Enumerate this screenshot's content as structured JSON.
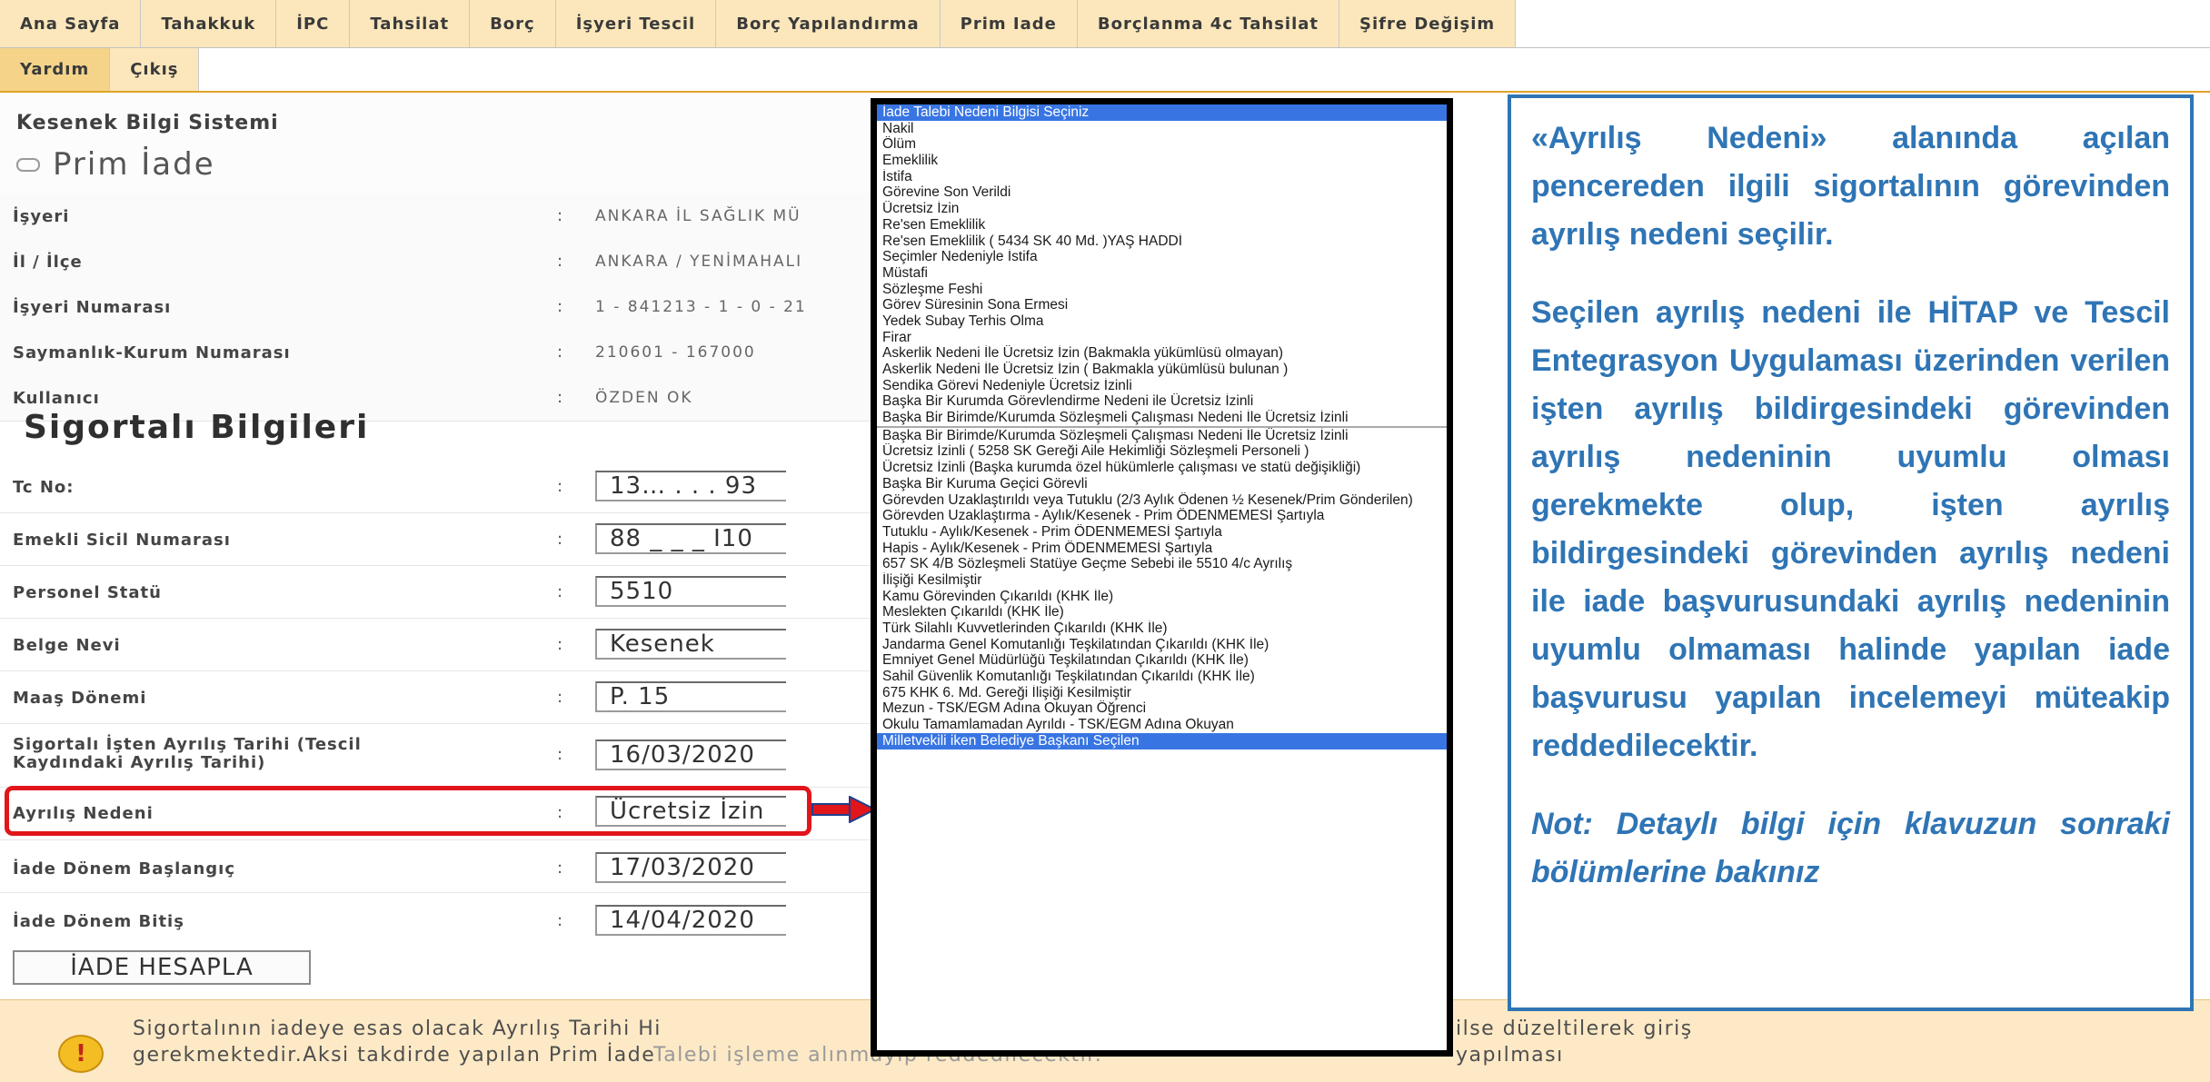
{
  "nav": {
    "row1": [
      "Ana Sayfa",
      "Tahakkuk",
      "İPC",
      "Tahsilat",
      "Borç",
      "İşyeri Tescil",
      "Borç Yapılandırma",
      "Prim Iade",
      "Borçlanma 4c Tahsilat",
      "Şifre Değişim"
    ],
    "row2": [
      "Yardım",
      "Çıkış"
    ]
  },
  "header": {
    "app_title": "Kesenek Bilgi Sistemi",
    "page_title": "Prim İade"
  },
  "info": {
    "isyeri": {
      "label": "İşyeri",
      "value": "ANKARA İL SAĞLIK MÜ"
    },
    "il_ilce": {
      "label": "İl / İlçe",
      "value": "ANKARA / YENİMAHALI"
    },
    "isyeri_no": {
      "label": "İşyeri Numarası",
      "value": "1 - 841213 - 1 - 0 - 21"
    },
    "saymanlik": {
      "label": "Saymanlık-Kurum Numarası",
      "value": "210601 - 167000"
    },
    "kullanici": {
      "label": "Kullanıcı",
      "value": "ÖZDEN OK"
    }
  },
  "section_title": "Sigortalı Bilgileri",
  "form": {
    "tc": {
      "label": "Tc No:",
      "value": "13…  . . .   93"
    },
    "emekli": {
      "label": "Emekli Sicil Numarası",
      "value": "88 _ _ _ I10"
    },
    "statu": {
      "label": "Personel Statü",
      "value": "5510"
    },
    "belge": {
      "label": "Belge Nevi",
      "value": "Kesenek"
    },
    "maas": {
      "label": "Maaş Dönemi",
      "value": "P. 15"
    },
    "ayrilis_tarihi": {
      "label_line1": "Sigortalı İşten Ayrılış Tarihi (Tescil",
      "label_line2": "Kaydındaki Ayrılış Tarihi)",
      "value": "16/03/2020"
    },
    "ayrilis_nedeni": {
      "label": "Ayrılış Nedeni",
      "value": "Ücretsiz İzin"
    },
    "baslangic": {
      "label": "İade Dönem Başlangıç",
      "value": "17/03/2020"
    },
    "bitis": {
      "label": "İade Dönem Bitiş",
      "value": "14/04/2020"
    }
  },
  "colon": ":",
  "button": "İADE HESAPLA",
  "warning": {
    "icon": "!",
    "line1": "Sigortalının iadeye esas olacak Ayrılış Tarihi Hi",
    "line1b": "ilse düzeltilerek giriş yapılması",
    "line2": "gerekmektedir.Aksi takdirde yapılan Prim İade",
    "line2b": "Talebi işleme alınmayıp reddedilecektir."
  },
  "dropdown": {
    "options": [
      "İade Talebi Nedeni Bilgisi Seçiniz",
      "Nakil",
      "Ölüm",
      "Emeklilik",
      "İstifa",
      "Görevine Son Verildi",
      "Ücretsiz İzin",
      "Re'sen Emeklilik",
      "Re'sen Emeklilik ( 5434 SK 40 Md. )YAŞ HADDİ",
      "Seçimler Nedeniyle İstifa",
      "Müstafi",
      "Sözleşme Feshi",
      "Görev Süresinin Sona Ermesi",
      "Yedek Subay Terhis Olma",
      "Firar",
      "Askerlik Nedeni İle Ücretsiz İzin (Bakmakla yükümlüsü olmayan)",
      "Askerlik Nedeni İle Ücretsiz İzin ( Bakmakla yükümlüsü bulunan )",
      "Sendika Görevi Nedeniyle Ücretsiz İzinli",
      "Başka Bir Kurumda Görevlendirme Nedeni ile Ücretsiz İzinli",
      "Başka Bir Birimde/Kurumda Sözleşmeli Çalışması Nedeni İle Ücretsiz İzinli",
      "Başka Bir Birimde/Kurumda Sözleşmeli Çalışması Nedeni İle Ücretsiz İzinli",
      "Ücretsiz İzinli ( 5258 SK Gereği Aile Hekimliği Sözleşmeli Personeli )",
      "Ücretsiz İzinli (Başka kurumda özel hükümlerle çalışması ve statü değişikliği)",
      "Başka Bir Kuruma Geçici Görevli",
      "Görevden Uzaklaştırıldı veya Tutuklu (2/3 Aylık Ödenen ½ Kesenek/Prim Gönderilen)",
      "Görevden Uzaklaştırma - Aylık/Kesenek - Prim ÖDENMEMESİ Şartıyla",
      "Tutuklu - Aylık/Kesenek - Prim ÖDENMEMESİ Şartıyla",
      "Hapis - Aylık/Kesenek - Prim ÖDENMEMESİ Şartıyla",
      "657 SK 4/B Sözleşmeli Statüye Geçme Sebebi ile 5510 4/c Ayrılış",
      "İlişiği Kesilmiştir",
      "Kamu Görevinden Çıkarıldı (KHK İle)",
      "Meslekten Çıkarıldı (KHK İle)",
      "Türk Silahlı Kuvvetlerinden Çıkarıldı (KHK İle)",
      "Jandarma Genel Komutanlığı Teşkilatından Çıkarıldı (KHK İle)",
      "Emniyet Genel Müdürlüğü Teşkilatından Çıkarıldı (KHK İle)",
      "Sahil Güvenlik Komutanlığı Teşkilatından Çıkarıldı (KHK İle)",
      "675 KHK 6. Md. Gereği İlişiği Kesilmiştir",
      "Mezun - TSK/EGM Adına Okuyan Öğrenci",
      "Okulu Tamamlamadan Ayrıldı - TSK/EGM Adına Okuyan",
      "Milletvekili iken Belediye Başkanı Seçilen"
    ]
  },
  "callout": {
    "p1": "«Ayrılış Nedeni» alanında açılan pencereden ilgili sigortalının görevinden ayrılış nedeni seçilir.",
    "p2": "Seçilen ayrılış nedeni ile HİTAP ve Tescil Entegrasyon Uygulaması üzerinden verilen işten ayrılış bildirgesindeki görevinden ayrılış nedeninin uyumlu olması gerekmekte olup, işten ayrılış bildirgesindeki görevinden ayrılış nedeni ile iade başvurusundaki ayrılış nedeninin uyumlu olmaması halinde yapılan iade başvurusu yapılan incelemeyi müteakip reddedilecektir.",
    "note": "Not: Detaylı bilgi için klavuzun sonraki bölümlerine bakınız"
  },
  "colors": {
    "tab_bg": "#fbe7bb",
    "highlight": "#e0161b",
    "callout": "#2f75b5",
    "select": "#3875e3"
  }
}
